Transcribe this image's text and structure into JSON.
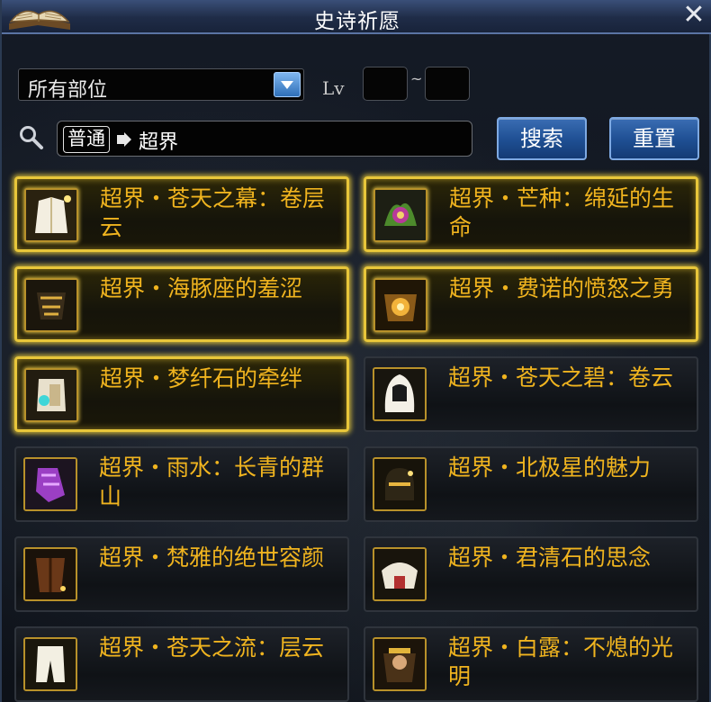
{
  "window": {
    "title": "史诗祈愿"
  },
  "filter": {
    "slot_value": "所有部位",
    "lv_label": "Lv",
    "lv_min": "",
    "lv_max": "",
    "lv_separator": "~"
  },
  "search": {
    "scope_chip": "普通",
    "query": "超界",
    "search_button": "搜索",
    "reset_button": "重置"
  },
  "items": [
    {
      "name": "超界・苍天之幕：卷层云",
      "highlighted": true,
      "icon": "white-coat-icon"
    },
    {
      "name": "超界・芒种：绵延的生命",
      "highlighted": true,
      "icon": "green-flower-icon"
    },
    {
      "name": "超界・海豚座的羞涩",
      "highlighted": true,
      "icon": "dark-armor-icon"
    },
    {
      "name": "超界・费诺的愤怒之勇",
      "highlighted": true,
      "icon": "gold-armor-icon"
    },
    {
      "name": "超界・梦纤石的牵绊",
      "highlighted": true,
      "icon": "crystal-gloves-icon"
    },
    {
      "name": "超界・苍天之碧：卷云",
      "highlighted": false,
      "icon": "white-hood-icon"
    },
    {
      "name": "超界・雨水：长青的群山",
      "highlighted": false,
      "icon": "purple-gauntlet-icon"
    },
    {
      "name": "超界・北极星的魅力",
      "highlighted": false,
      "icon": "dark-helmet-icon"
    },
    {
      "name": "超界・梵雅的绝世容颜",
      "highlighted": false,
      "icon": "brown-cloak-icon"
    },
    {
      "name": "超界・君清石的思念",
      "highlighted": false,
      "icon": "white-pauldron-icon"
    },
    {
      "name": "超界・苍天之流：层云",
      "highlighted": false,
      "icon": "white-pants-icon"
    },
    {
      "name": "超界・白露：不熄的光明",
      "highlighted": false,
      "icon": "portrait-armor-icon"
    }
  ],
  "colors": {
    "highlight_border": "#e8c63a",
    "item_text": "#f0b41f",
    "button_blue": "#1e4e92"
  }
}
